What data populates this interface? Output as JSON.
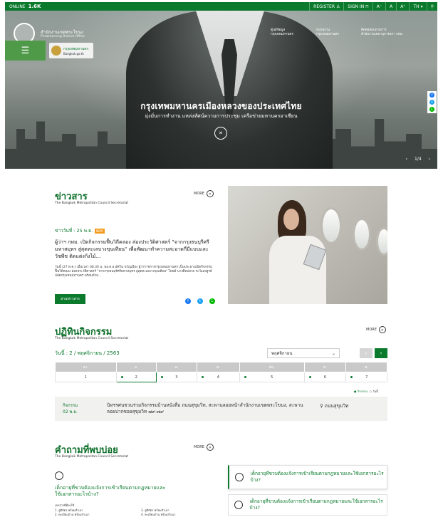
{
  "topbar": {
    "online_label": "ONLINE",
    "online_count": "1.6K",
    "register": "REGISTER",
    "signin": "SIGN IN",
    "font_small": "A⁻",
    "font_normal": "A",
    "font_large": "A⁺",
    "language": "TH"
  },
  "header": {
    "org_name": "สำนักงานเขตพระโขนง",
    "org_name_en": "Phrakhanong District Office",
    "nav": [
      {
        "line1": "ศูนย์ข้อมูล",
        "line2": "กรุงเทพมหานคร"
      },
      {
        "line1": "หน่วยงาน",
        "line2": "กรุงเทพมหานคร"
      },
      {
        "line1": "ติดต่อสอบถามการ",
        "line2": "สำนักงานเลขานุการสภา กทม."
      }
    ],
    "menu_icon": "☰",
    "bkk_logo_line1": "กรุงเทพมหานคร",
    "bkk_logo_line2": "Bangkok.go.th"
  },
  "hero": {
    "title": "กรุงเทพมหานครเมืองหลวงของประเทศไทย",
    "subtitle": "มุ่งมั่นการทำงาน แหล่งทัศน์ความการประชุม เครือข่ายมหานครอาเซียน",
    "more_icon": "»",
    "slide_prev": "‹",
    "slide_counter": "1/4",
    "slide_next": "›"
  },
  "share": {
    "facebook": "f",
    "twitter": "t",
    "line": "L"
  },
  "news": {
    "title": "ข่าวสาร",
    "subtitle": "The Bangkok Metropolitan Council Secretariat",
    "more_label": "MORE",
    "more_icon": "»",
    "date": "ข่าววันที่ : 25 พ.ย.",
    "badge": "NEW",
    "headline": "ผู้ว่าฯ กทม. เปิดกิจกรรมฟื้นวิถีคลอง ส่องประวัติศาสตร์ \"จากกรุงธนบุรีศรีมหาสมุทร สู่สุดทะเลบางขุนเทียน\" เพื่อพัฒนาทำความสะอาดกี่มีแบบและวัชพืช ติดแต่งกิ่งไม้...",
    "body": "วันนี้ (27 ต.ค.) เมื่อเวลา 08.30 น. พล.ต.อ.อัศวิน ขวัญเมือง ผู้ว่าราชการกรุงเทพมหานคร เป็นประธานเปิดกิจกรรมฟื้นวิถีคลอง ส่องประวัติศาสตร์ \"จากกรุงธนบุรีศรีมหาสมุทร สู่สุดทะเลบางขุนเทียน\" โดยมี นางศิลปสวย ระวีแสงสูรย์ ปลัดกรุงเทพมหานคร พร้อมด้วย...",
    "read_button": "อ่านข่าวสาร"
  },
  "calendar": {
    "title": "ปฏิทินกิจกรรม",
    "subtitle": "The Bangkok Metropolitan Council Secretariat",
    "more_label": "MORE",
    "date_label": "วันนี้ : 2 / พฤศจิกายน / 2563",
    "month_select": "พฤศจิกายน",
    "prev": "‹",
    "next": "›",
    "days": [
      "อา.",
      "จ.",
      "อ.",
      "พ.",
      "พฤ.",
      "ศ.",
      "ส."
    ],
    "dates": [
      "1",
      "2",
      "3",
      "4",
      "5",
      "6",
      "7"
    ],
    "legend_activity": "● กิจกรรม",
    "legend_today": "○ วันนี้",
    "activity_label": "กิจกรรม",
    "activity_date": "02 พ.ย.",
    "activity_text": "นิทรรศนชวนร่วมกิจกรรมบ้านหนังสือ ถนนสุขุมวิท, สะพานลอยหน้าสำนักงานเขตพระโขนง, สะพานลอยปากซอยสุขุมวิท ๗๙-๗๙",
    "activity_location": "ถนนสุขุมวิท"
  },
  "faq": {
    "title": "คำถามที่พบบ่อย",
    "subtitle": "The Bangkok Metropolitan Council Secretariat",
    "more_label": "MORE",
    "question": "เด็กอายุที่ขวบต้องแจ้งการเข้าเรียนตามกฎหมายและใช้เอกสารอะไรบ้าง?",
    "docs_heading": "เอกสารที่ต้องใช้",
    "docs": [
      "1. สูติบัตร พร้อมสำเนา",
      "2. ทะเบียนบ้าน พร้อมสำเนา",
      "3. สูติบัตร พร้อมสำเนา",
      "4. ทะเบียนบ้าน พร้อมสำเนา"
    ],
    "cards": [
      "เด็กอายุที่ขวบต้องแจ้งการเข้าเรียนตามกฎหมายและใช้เอกสารอะไรบ้าง?",
      "เด็กอายุที่ขวบต้องแจ้งการเข้าเรียนตามกฎหมายและใช้เอกสารอะไรบ้าง?"
    ]
  },
  "colors": {
    "brand_green": "#0b7a2d",
    "accent_orange": "#f39a1e"
  }
}
